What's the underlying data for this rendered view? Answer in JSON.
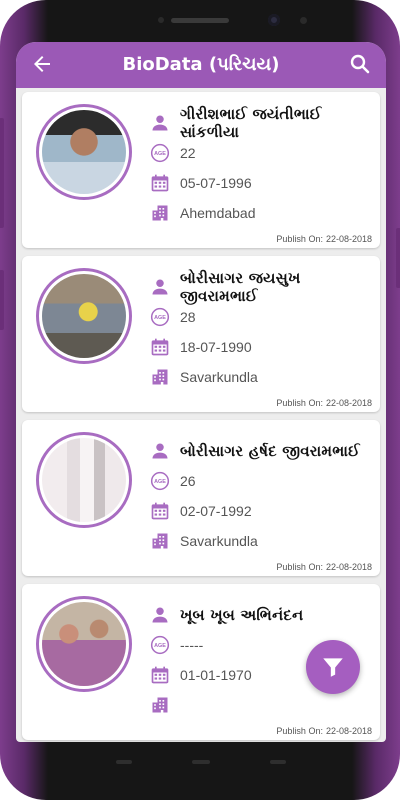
{
  "app": {
    "title": "BioData (પરિચય)",
    "accent_color": "#9b59b6",
    "back_icon": "arrow-left-icon",
    "search_icon": "search-icon"
  },
  "profiles": [
    {
      "name": "ગીરીશભાઈ જયંતીભાઈ સાંકળીયા",
      "age": "22",
      "dob": "05-07-1996",
      "city": "Ahemdabad",
      "publish_label": "Publish On:",
      "publish_date": "22-08-2018"
    },
    {
      "name": "બોરીસાગર જયસુખ જીવરામભાઈ",
      "age": "28",
      "dob": "18-07-1990",
      "city": "Savarkundla",
      "publish_label": "Publish On:",
      "publish_date": "22-08-2018"
    },
    {
      "name": "બોરીસાગર હર્ષદ જીવરામભાઈ",
      "age": "26",
      "dob": "02-07-1992",
      "city": "Savarkundla",
      "publish_label": "Publish On:",
      "publish_date": "22-08-2018"
    },
    {
      "name": "ખૂબ ખૂબ અભિનંદન",
      "age": "-----",
      "dob": "01-01-1970",
      "city": "",
      "publish_label": "Publish On:",
      "publish_date": "22-08-2018"
    }
  ],
  "icons": {
    "person": "person-icon",
    "age": "age-icon",
    "calendar": "calendar-icon",
    "city": "building-icon",
    "filter": "filter-icon"
  },
  "age_badge_text": "AGE"
}
